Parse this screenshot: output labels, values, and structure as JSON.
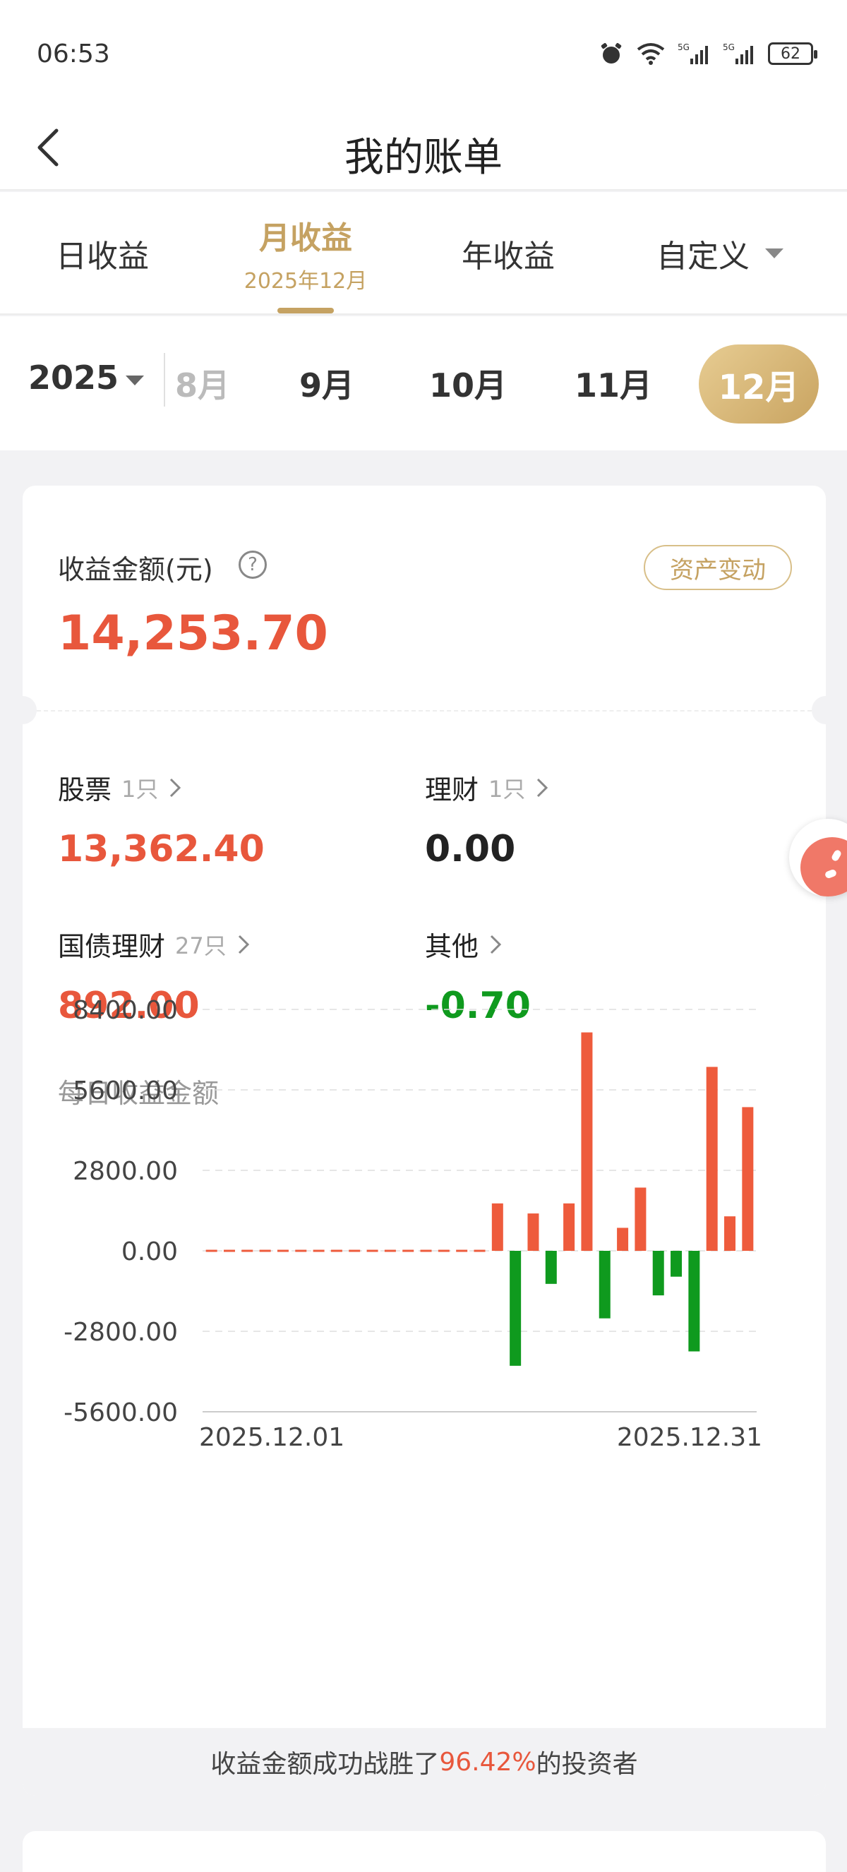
{
  "status": {
    "time": "06:53",
    "battery": "62"
  },
  "header": {
    "title": "我的账单"
  },
  "tabs": [
    {
      "label": "日收益"
    },
    {
      "label": "月收益",
      "sub": "2025年12月"
    },
    {
      "label": "年收益"
    },
    {
      "label": "自定义"
    }
  ],
  "months": {
    "year": "2025",
    "items": [
      "8月",
      "9月",
      "10月",
      "11月",
      "12月"
    ]
  },
  "summary": {
    "label": "收益金额(元)",
    "help": "?",
    "asset_button": "资产变动",
    "total": "14,253.70"
  },
  "categories": [
    {
      "name": "股票",
      "count": "1只",
      "value": "13,362.40"
    },
    {
      "name": "理财",
      "count": "1只",
      "value": "0.00"
    },
    {
      "name": "国债理财",
      "count": "27只",
      "value": "892.00"
    },
    {
      "name": "其他",
      "count": "",
      "value": "-0.70"
    }
  ],
  "daily_label": "每日收益金额",
  "chart_data": {
    "type": "bar",
    "x": [
      "2025.12.01",
      "2025.12.02",
      "2025.12.03",
      "2025.12.04",
      "2025.12.05",
      "2025.12.06",
      "2025.12.07",
      "2025.12.08",
      "2025.12.09",
      "2025.12.10",
      "2025.12.11",
      "2025.12.12",
      "2025.12.13",
      "2025.12.14",
      "2025.12.15",
      "2025.12.16",
      "2025.12.17",
      "2025.12.18",
      "2025.12.19",
      "2025.12.20",
      "2025.12.21",
      "2025.12.22",
      "2025.12.23",
      "2025.12.24",
      "2025.12.25",
      "2025.12.26",
      "2025.12.27",
      "2025.12.28",
      "2025.12.29",
      "2025.12.30",
      "2025.12.31"
    ],
    "values": [
      0,
      0,
      0,
      0,
      0,
      0,
      0,
      0,
      0,
      0,
      0,
      0,
      0,
      0,
      0,
      0,
      1650,
      -4000,
      1300,
      -1150,
      1650,
      7600,
      -2350,
      800,
      2200,
      -1550,
      -900,
      -3500,
      6400,
      1200,
      5000
    ],
    "yticks": [
      "8400.00",
      "5600.00",
      "2800.00",
      "0.00",
      "-2800.00",
      "-5600.00"
    ],
    "ylim": [
      -5600,
      8400
    ],
    "xtick_labels": [
      "2025.12.01",
      "2025.12.31"
    ],
    "colors": {
      "positive": "#ee5b3c",
      "negative": "#0f9a1e",
      "zero": "#ee5b3c"
    },
    "grid": true
  },
  "footer": {
    "prefix": "收益金额成功战胜了",
    "pct": "96.42%",
    "suffix": "的投资者"
  }
}
